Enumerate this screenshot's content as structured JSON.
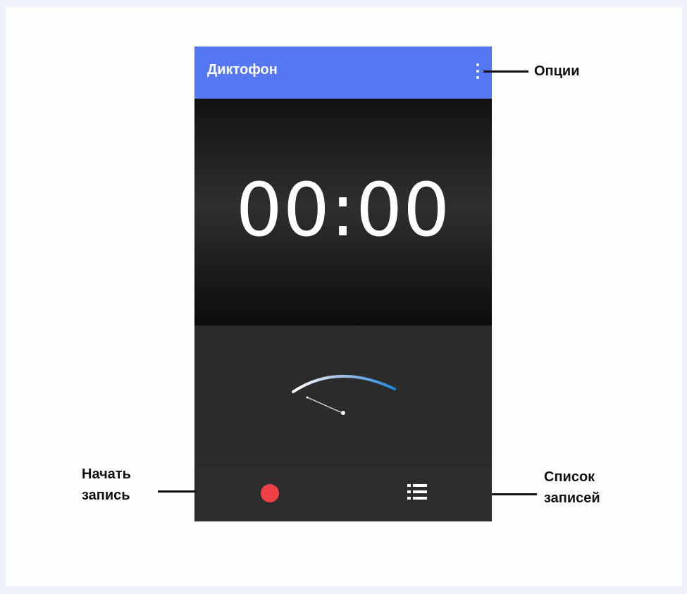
{
  "app": {
    "title": "Диктофон"
  },
  "timer": {
    "value": "00:00"
  },
  "icons": {
    "options": "vertical-dots-icon",
    "record": "record-dot-icon",
    "list": "list-icon",
    "meter": "level-meter-gauge"
  },
  "meter": {
    "level": 0
  },
  "colors": {
    "app_bar": "#5577f2",
    "record": "#ef4048",
    "background_dark": "#2b2b2b"
  },
  "callouts": {
    "options": "Опции",
    "start_recording": "Начать\nзапись",
    "recordings_list": "Список\nзаписей"
  }
}
